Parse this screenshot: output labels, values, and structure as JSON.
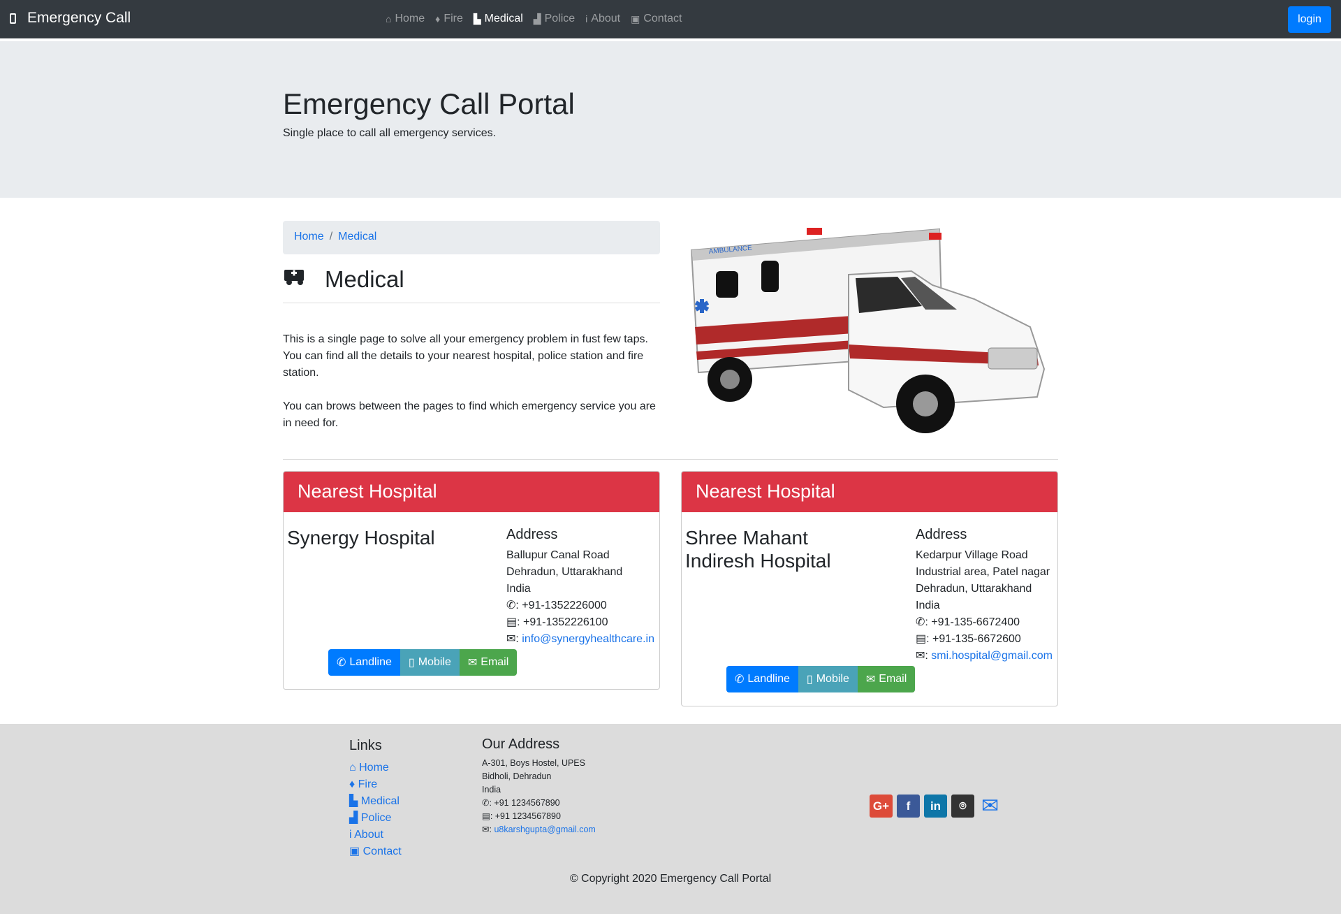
{
  "navbar": {
    "brand": "Emergency Call",
    "items": [
      {
        "icon": "home-icon",
        "glyph": "⌂",
        "label": "Home"
      },
      {
        "icon": "fire-icon",
        "glyph": "🔥",
        "label": "Fire"
      },
      {
        "icon": "ambulance-icon",
        "glyph": "🚑",
        "label": "Medical",
        "active": true
      },
      {
        "icon": "car-icon",
        "glyph": "🚓",
        "label": "Police"
      },
      {
        "icon": "info-icon",
        "glyph": "ℹ",
        "label": "About"
      },
      {
        "icon": "contact-card-icon",
        "glyph": "▣",
        "label": "Contact"
      }
    ],
    "login": "login"
  },
  "jumbotron": {
    "title": "Emergency Call Portal",
    "subtitle": "Single place to call all emergency services."
  },
  "breadcrumb": [
    "Home",
    "/",
    "Medical"
  ],
  "section": {
    "title": "Medical",
    "intro": [
      "This is a single page to solve all your emergency problem in fust few taps. You can find all the details to your nearest hospital, police station and fire station.",
      "You can brows between the pages to find which emergency service you are in need for."
    ]
  },
  "hospitals": [
    {
      "header": "Nearest Hospital",
      "name": "Synergy Hospital",
      "address_heading": "Address",
      "address_lines": [
        "Ballupur Canal Road",
        "Dehradun, Uttarakhand",
        "India"
      ],
      "phone": ": +91-1352226000",
      "fax": ": +91-1352226100",
      "email": "info@synergyhealthcare.in",
      "buttons": [
        "Landline",
        "Mobile",
        "Email"
      ]
    },
    {
      "header": "Nearest Hospital",
      "name": "Shree Mahant Indiresh Hospital",
      "address_heading": "Address",
      "address_lines": [
        "Kedarpur Village Road",
        "Industrial area, Patel nagar",
        "Dehradun, Uttarakhand",
        "India"
      ],
      "phone": ": +91-135-6672400",
      "fax": ": +91-135-6672600",
      "email": "smi.hospital@gmail.com",
      "buttons": [
        "Landline",
        "Mobile",
        "Email"
      ]
    }
  ],
  "footer": {
    "links_heading": "Links",
    "links": [
      "Home",
      "Fire",
      "Medical",
      "Police",
      "About",
      "Contact"
    ],
    "address_heading": "Our Address",
    "address_lines": [
      "A-301, Boys Hostel, UPES",
      "Bidholi, Dehradun",
      "India"
    ],
    "phone": ": +91 1234567890",
    "fax": ": +91 1234567890",
    "email": "u8karshgupta@gmail.com",
    "social": [
      {
        "name": "google-plus",
        "text": "G+",
        "color": "#dd4b39"
      },
      {
        "name": "facebook",
        "text": "f",
        "color": "#3b5998"
      },
      {
        "name": "linkedin",
        "text": "in",
        "color": "#0e76a8"
      },
      {
        "name": "github",
        "text": "⌾",
        "color": "#333333"
      }
    ],
    "copyright": "© Copyright 2020 Emergency Call Portal"
  }
}
